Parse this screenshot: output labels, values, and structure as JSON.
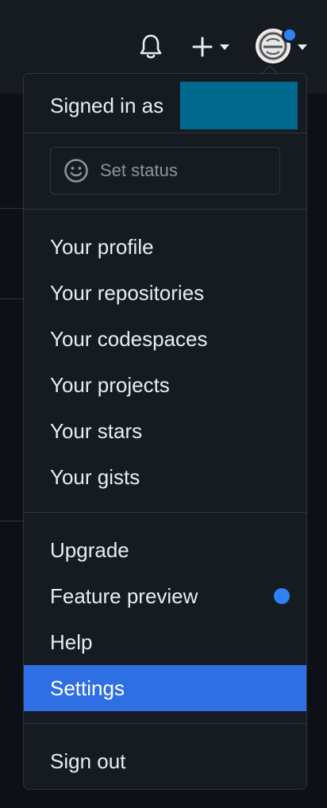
{
  "header": {
    "icons": [
      "bell-icon",
      "plus-icon",
      "avatar"
    ]
  },
  "menu": {
    "signed_in_prefix": "Signed in as",
    "status_button": {
      "label": "Set status",
      "icon": "smiley-icon"
    },
    "section_one": [
      {
        "label": "Your profile"
      },
      {
        "label": "Your repositories"
      },
      {
        "label": "Your codespaces"
      },
      {
        "label": "Your projects"
      },
      {
        "label": "Your stars"
      },
      {
        "label": "Your gists"
      }
    ],
    "section_two": [
      {
        "label": "Upgrade"
      },
      {
        "label": "Feature preview"
      },
      {
        "label": "Help"
      },
      {
        "label": "Settings"
      }
    ],
    "active_item": "Settings",
    "sign_out": "Sign out"
  },
  "colors": {
    "accent_blue": "#2f81f7",
    "active_bg": "#2f6fe4",
    "menu_bg": "#161b22",
    "page_bg": "#0d1117",
    "border": "#30363d",
    "text": "#e6edf3",
    "muted_text": "#8b949e",
    "redaction": "#006a8e"
  }
}
